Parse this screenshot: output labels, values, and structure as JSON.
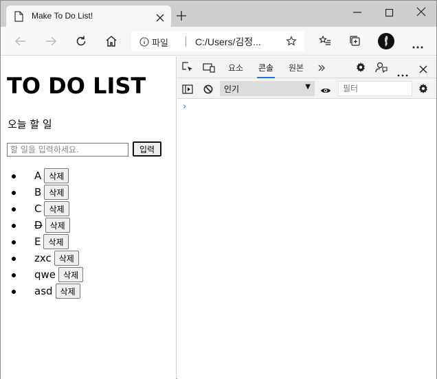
{
  "browser": {
    "tab_title": "Make To Do List!",
    "address": {
      "scheme_label": "파일",
      "url": "C:/Users/김정..."
    }
  },
  "page": {
    "heading": "TO DO LIST",
    "subtitle": "오늘 할 일",
    "input_placeholder": "할 일을 입력하세요.",
    "input_value": "",
    "add_button": "입력",
    "delete_label": "삭제",
    "items": [
      {
        "text": "A",
        "done": false
      },
      {
        "text": "B",
        "done": false
      },
      {
        "text": "C",
        "done": false
      },
      {
        "text": "D",
        "done": true
      },
      {
        "text": "E",
        "done": false
      },
      {
        "text": "zxc",
        "done": false
      },
      {
        "text": "qwe",
        "done": false
      },
      {
        "text": "asd",
        "done": false
      }
    ]
  },
  "devtools": {
    "tabs": [
      "요소",
      "콘솔",
      "원본"
    ],
    "active_tab": "콘솔",
    "context_selector": "인기",
    "filter_placeholder": "필터",
    "prompt": "›",
    "accent_color": "#1a73e8"
  }
}
